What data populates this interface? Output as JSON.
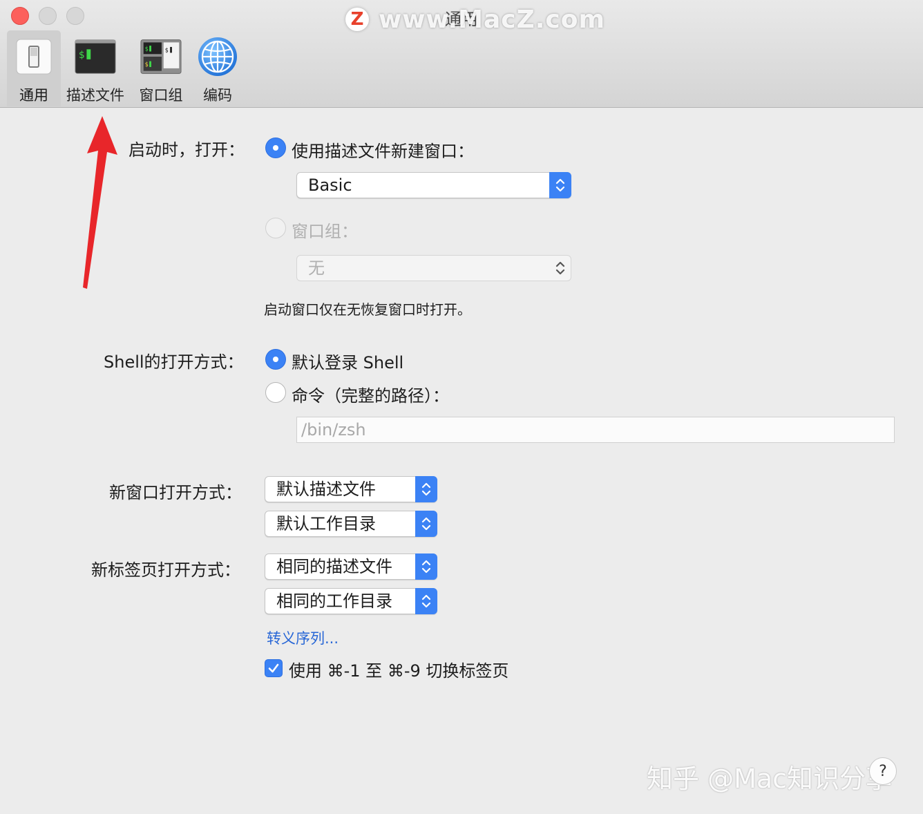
{
  "window": {
    "title": "通用"
  },
  "watermark_top": {
    "logo": "Z",
    "text": "www.MacZ.com"
  },
  "watermark_bottom": {
    "text": "知乎 @Mac知识分享"
  },
  "toolbar": {
    "items": [
      {
        "label": "通用",
        "icon": "switch-icon",
        "active": true
      },
      {
        "label": "描述文件",
        "icon": "terminal-profile-icon",
        "active": false
      },
      {
        "label": "窗口组",
        "icon": "window-group-icon",
        "active": false
      },
      {
        "label": "编码",
        "icon": "globe-icon",
        "active": false
      }
    ]
  },
  "startup": {
    "label": "启动时，打开：",
    "option_profile": {
      "label": "使用描述文件新建窗口：",
      "selected": true
    },
    "profile_popup": {
      "value": "Basic"
    },
    "option_group": {
      "label": "窗口组：",
      "selected": false,
      "enabled": false
    },
    "group_popup": {
      "value": "无",
      "enabled": false
    },
    "note": "启动窗口仅在无恢复窗口时打开。"
  },
  "shell": {
    "label": "Shell的打开方式：",
    "option_default": {
      "label": "默认登录 Shell",
      "selected": true
    },
    "option_command": {
      "label": "命令（完整的路径）：",
      "selected": false
    },
    "command_field": {
      "placeholder": "/bin/zsh",
      "value": ""
    }
  },
  "new_window": {
    "label": "新窗口打开方式：",
    "profile_popup": {
      "value": "默认描述文件"
    },
    "directory_popup": {
      "value": "默认工作目录"
    }
  },
  "new_tab": {
    "label": "新标签页打开方式：",
    "profile_popup": {
      "value": "相同的描述文件"
    },
    "directory_popup": {
      "value": "相同的工作目录"
    }
  },
  "escape_link": {
    "label": "转义序列..."
  },
  "tab_switch_checkbox": {
    "label": "使用 ⌘-1 至 ⌘-9 切换标签页",
    "checked": true
  },
  "help_button": {
    "label": "?"
  },
  "colors": {
    "accent": "#3b82f5",
    "link": "#2766d6",
    "close": "#fc605c",
    "annotation_arrow": "#e8262a"
  }
}
